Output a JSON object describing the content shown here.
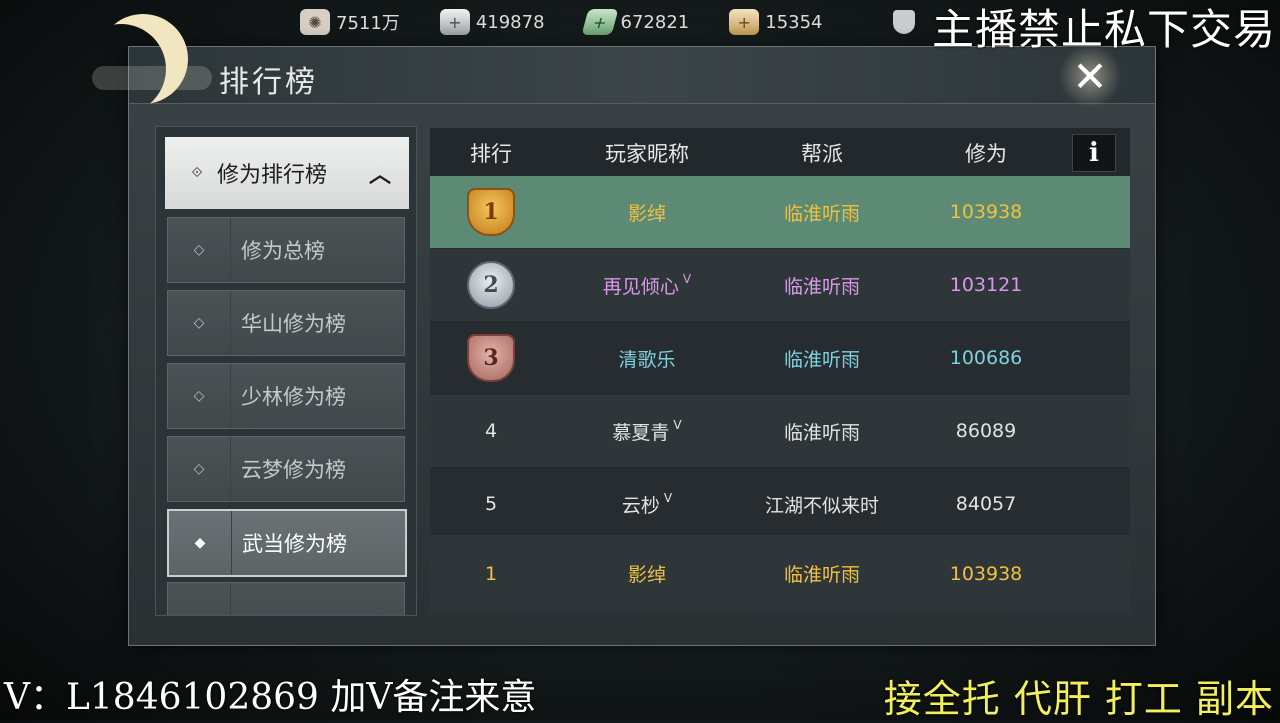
{
  "currency": [
    {
      "icon": "film-reel-icon",
      "value": "7511万"
    },
    {
      "icon": "silver-ingot-icon",
      "value": "419878"
    },
    {
      "icon": "jade-icon",
      "value": "672821"
    },
    {
      "icon": "gold-ingot-icon",
      "value": "15354"
    }
  ],
  "overlay": {
    "top_right": "主播禁止私下交易",
    "bottom_left": "V：L1846102869 加V备注来意",
    "bottom_right": "接全托 代肝 打工 副本"
  },
  "panel": {
    "title": "排行榜",
    "close_label": "✕"
  },
  "categories": {
    "group_label": "修为排行榜",
    "items": [
      {
        "label": "修为总榜",
        "active": false
      },
      {
        "label": "华山修为榜",
        "active": false
      },
      {
        "label": "少林修为榜",
        "active": false
      },
      {
        "label": "云梦修为榜",
        "active": false
      },
      {
        "label": "武当修为榜",
        "active": true
      }
    ]
  },
  "table": {
    "headers": [
      "排行",
      "玩家昵称",
      "帮派",
      "修为"
    ],
    "info_label": "i",
    "rows": [
      {
        "rank": "1",
        "name": "影绰",
        "guild": "临淮听雨",
        "score": "103938",
        "badge": "gold",
        "v": false,
        "color": "#f0c040"
      },
      {
        "rank": "2",
        "name": "再见倾心",
        "guild": "临淮听雨",
        "score": "103121",
        "badge": "silver",
        "v": true,
        "color": "#d79ae6"
      },
      {
        "rank": "3",
        "name": "清歌乐",
        "guild": "临淮听雨",
        "score": "100686",
        "badge": "bronze",
        "v": false,
        "color": "#7ed1de"
      },
      {
        "rank": "4",
        "name": "慕夏青",
        "guild": "临淮听雨",
        "score": "86089",
        "badge": "",
        "v": true,
        "color": "#e2e2e2"
      },
      {
        "rank": "5",
        "name": "云杪",
        "guild": "江湖不似来时",
        "score": "84057",
        "badge": "",
        "v": true,
        "color": "#e2e2e2"
      },
      {
        "rank": "1",
        "name": "影绰",
        "guild": "临淮听雨",
        "score": "103938",
        "badge": "",
        "v": false,
        "color": "#f0c040"
      }
    ],
    "v_mark": "ᐯ"
  },
  "colors": {
    "first_row_bg": "#5c8a74",
    "guild_gold": "#f0c040"
  }
}
